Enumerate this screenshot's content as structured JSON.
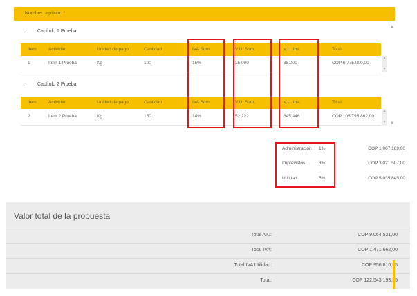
{
  "header": {
    "column_label": "Nombre capítulo",
    "caret": "*"
  },
  "columns": {
    "item": "Item",
    "actividad": "Actividad",
    "unidad": "Unidad de pago",
    "cantidad": "Cantidad",
    "iva": "IVA Sum.",
    "vu_sum": "V.U. Sum.",
    "vu_ins": "V.U. Ins.",
    "total": "Total"
  },
  "chapters": [
    {
      "title": "Capítulo 1 Prueba",
      "row": {
        "item": "1",
        "actividad": "Item 1 Prueba",
        "unidad": "Kg",
        "cantidad": "100",
        "iva": "15%",
        "vu_sum": "25.000",
        "vu_ins": "38.000",
        "total": "COP 6.775.000,00"
      }
    },
    {
      "title": "Capítulo 2 Prueba",
      "row": {
        "item": "2",
        "actividad": "Item 2 Prueba",
        "unidad": "Kg",
        "cantidad": "150",
        "iva": "14%",
        "vu_sum": "52.222",
        "vu_ins": "645.446",
        "total": "COP 105.795.862,00"
      }
    }
  ],
  "aiu": [
    {
      "label": "Administración",
      "pct": "1%",
      "value": "COP 1.007.169,00"
    },
    {
      "label": "Imprevistos",
      "pct": "3%",
      "value": "COP 3.021.507,00"
    },
    {
      "label": "Utilidad",
      "pct": "5%",
      "value": "COP 5.035.845,00"
    }
  ],
  "summary": {
    "title": "Valor total de la propuesta",
    "lines": [
      {
        "label": "Total AIU:",
        "value": "COP 9.064.521,00"
      },
      {
        "label": "Total IVA:",
        "value": "COP 1.471.662,00"
      },
      {
        "label": "Total IVA Utilidad:",
        "value": "COP 956.810,55"
      },
      {
        "label": "Total:",
        "value": "COP 122.543.193,55"
      }
    ]
  },
  "icons": {
    "collapse": "minus-icon",
    "scroll_up": "arrow-up-icon",
    "scroll_down": "arrow-down-icon"
  },
  "colors": {
    "accent": "#f6c000",
    "highlight": "#e8141c",
    "summary_bg": "#ececec"
  }
}
